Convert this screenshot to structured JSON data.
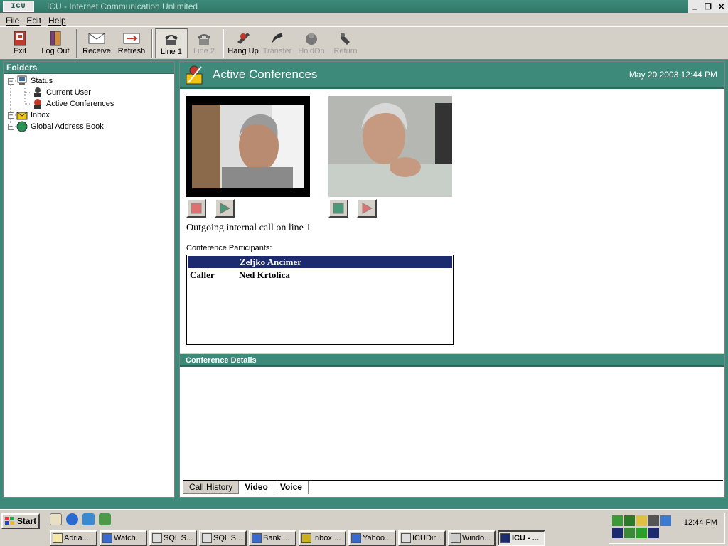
{
  "window": {
    "logo": "ICU",
    "title": "ICU - Internet Communication Unlimited",
    "controls": [
      "_",
      "❐",
      "✕"
    ]
  },
  "menu": [
    "File",
    "Edit",
    "Help"
  ],
  "toolbar": {
    "exit": "Exit",
    "logout": "Log Out",
    "receive": "Receive",
    "refresh": "Refresh",
    "line1": "Line 1",
    "line2": "Line 2",
    "hangup": "Hang Up",
    "transfer": "Transfer",
    "holdon": "HoldOn",
    "return": "Return"
  },
  "folders": {
    "header": "Folders",
    "tree": {
      "status": "Status",
      "current_user": "Current User",
      "active_conferences": "Active Conferences",
      "inbox": "Inbox",
      "global_address_book": "Global Address Book"
    }
  },
  "main": {
    "title": "Active Conferences",
    "datetime": "May 20 2003 12:44 PM",
    "call_status": "Outgoing internal call on line  1",
    "participants_label": "Conference Participants:",
    "participants": [
      {
        "role": "",
        "name": "Zeljko Ancimer"
      },
      {
        "role": "Caller",
        "name": "Ned Krtolica"
      }
    ],
    "details_header": "Conference Details",
    "tabs": [
      "Call History",
      "Video",
      "Voice"
    ]
  },
  "taskbar": {
    "start": "Start",
    "tasks": [
      "Adria...",
      "Watch...",
      "SQL S...",
      "SQL S...",
      "Bank ...",
      "Inbox ...",
      "Yahoo...",
      "ICUDir...",
      "Windo...",
      "ICU - ..."
    ],
    "clock": "12:44 PM"
  },
  "colors": {
    "accent": "#3d8a7a",
    "selection": "#1c2a70"
  }
}
